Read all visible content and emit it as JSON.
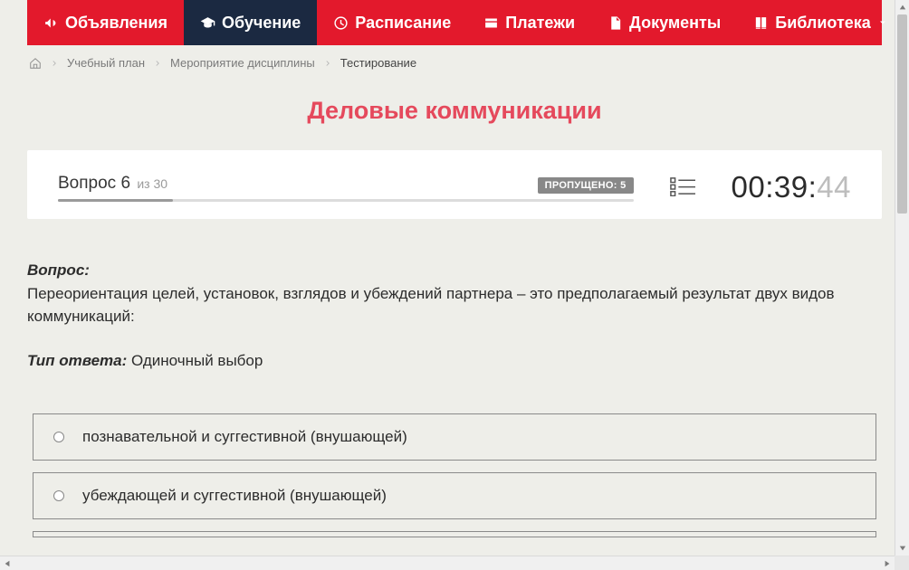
{
  "nav": {
    "items": [
      {
        "label": "Объявления",
        "active": false
      },
      {
        "label": "Обучение",
        "active": true
      },
      {
        "label": "Расписание",
        "active": false
      },
      {
        "label": "Платежи",
        "active": false
      },
      {
        "label": "Документы",
        "active": false
      },
      {
        "label": "Библиотека",
        "active": false,
        "dropdown": true
      }
    ]
  },
  "breadcrumb": {
    "items": [
      "Учебный план",
      "Мероприятие дисциплины"
    ],
    "current": "Тестирование"
  },
  "page_title": "Деловые коммуникации",
  "status": {
    "question_label": "Вопрос",
    "current_question": "6",
    "of_label": "из",
    "total_questions": "30",
    "skipped_label": "ПРОПУЩЕНО:",
    "skipped_count": "5",
    "progress_percent": 20
  },
  "timer": {
    "main": "00:39:",
    "seconds": "44"
  },
  "question": {
    "label": "Вопрос:",
    "text": "Переориентация целей, установок, взглядов и убеждений партнера – это предполагаемый результат двух видов коммуникаций:"
  },
  "answer_type": {
    "label": "Тип ответа:",
    "value": "Одиночный выбор"
  },
  "options": [
    "познавательной и суггестивной (внушающей)",
    "убеждающей и суггестивной (внушающей)"
  ]
}
